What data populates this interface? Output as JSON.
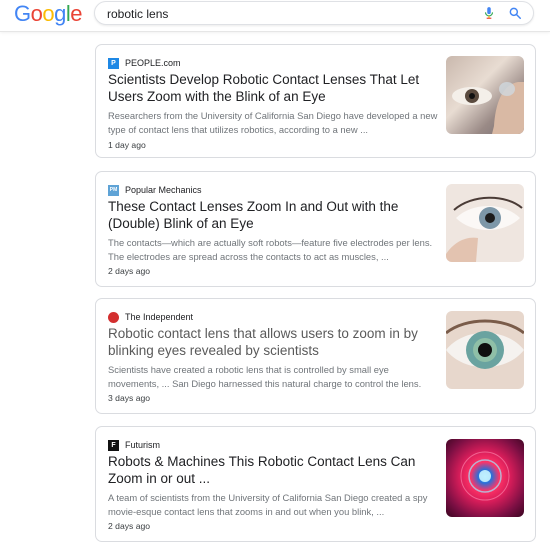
{
  "header": {
    "logo_letters": [
      "G",
      "o",
      "o",
      "g",
      "l",
      "e"
    ],
    "logo_colors": [
      "#4285F4",
      "#EA4335",
      "#FBBC05",
      "#4285F4",
      "#34A853",
      "#EA4335"
    ],
    "search_value": "robotic lens"
  },
  "results": [
    {
      "source": "PEOPLE.com",
      "favicon_text": "P",
      "favicon_color": "#1e88e5",
      "title": "Scientists Develop Robotic Contact Lenses That Let Users Zoom with the Blink of an Eye",
      "snippet": "Researchers from the University of California San Diego have developed a new type of contact lens that utilizes robotics, according to a new ...",
      "date": "1 day ago",
      "thumb": "finger-contact-lens-image"
    },
    {
      "source": "Popular Mechanics",
      "favicon_text": "PM",
      "favicon_color": "#5fa3d6",
      "title": "These Contact Lenses Zoom In and Out with the (Double) Blink of an Eye",
      "snippet": "The contacts—which are actually soft robots—feature five electrodes per lens. The electrodes are spread across the contacts to act as muscles, ...",
      "date": "2 days ago",
      "thumb": "eye-closeup-image"
    },
    {
      "source": "The Independent",
      "favicon_text": "",
      "favicon_color": "#d32f2f",
      "title": "Robotic contact lens that allows users to zoom in by blinking eyes revealed by scientists",
      "snippet": "Scientists have created a robotic lens that is controlled by small eye movements, ... San Diego harnessed this natural charge to control the lens.",
      "date": "3 days ago",
      "thumb": "green-eye-image"
    },
    {
      "source": "Futurism",
      "favicon_text": "F",
      "favicon_color": "#111111",
      "title": "Robots & Machines This Robotic Contact Lens Can Zoom in or out ...",
      "snippet": "A team of scientists from the University of California San Diego created a spy movie-esque contact lens that zooms in and out when you blink, ...",
      "date": "2 days ago",
      "thumb": "red-tunnel-image"
    }
  ]
}
